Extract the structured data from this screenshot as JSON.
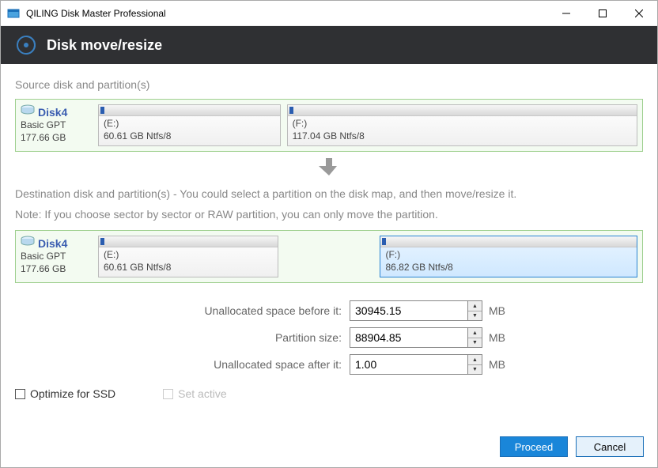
{
  "window": {
    "title": "QILING Disk Master Professional"
  },
  "header": {
    "title": "Disk move/resize"
  },
  "source": {
    "label": "Source disk and partition(s)",
    "disk": {
      "name": "Disk4",
      "type": "Basic GPT",
      "size": "177.66 GB"
    },
    "partitions": [
      {
        "letter": "(E:)",
        "desc": "60.61 GB Ntfs/8"
      },
      {
        "letter": "(F:)",
        "desc": "117.04 GB Ntfs/8"
      }
    ]
  },
  "dest": {
    "label": "Destination disk and partition(s) - You could select a partition on the disk map, and then move/resize it.",
    "note": "Note: If you choose sector by sector or RAW partition, you can only move the partition.",
    "disk": {
      "name": "Disk4",
      "type": "Basic GPT",
      "size": "177.66 GB"
    },
    "partitions": [
      {
        "letter": "(E:)",
        "desc": "60.61 GB Ntfs/8",
        "selected": false
      },
      {
        "letter": "(F:)",
        "desc": "86.82 GB Ntfs/8",
        "selected": true
      }
    ]
  },
  "form": {
    "before_label": "Unallocated space before it:",
    "before_value": "30945.15",
    "size_label": "Partition size:",
    "size_value": "88904.85",
    "after_label": "Unallocated space after it:",
    "after_value": "1.00",
    "unit": "MB"
  },
  "options": {
    "ssd": "Optimize for SSD",
    "setactive": "Set active"
  },
  "buttons": {
    "proceed": "Proceed",
    "cancel": "Cancel"
  }
}
